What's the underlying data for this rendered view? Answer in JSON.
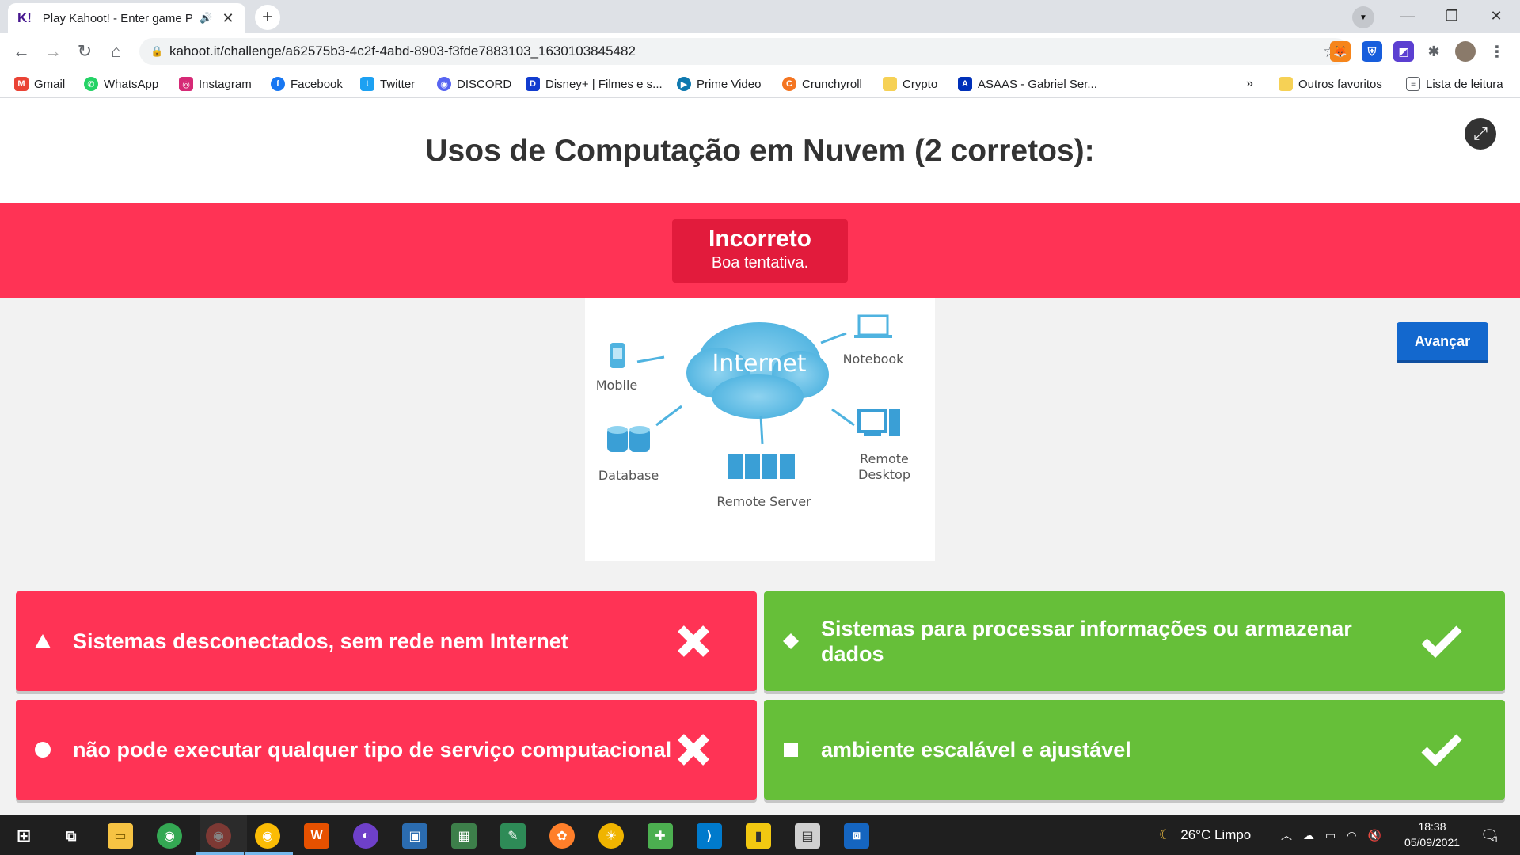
{
  "browser": {
    "tab": {
      "title": "Play Kahoot! - Enter game PIN",
      "favicon": "K!"
    },
    "url": "kahoot.it/challenge/a62575b3-4c2f-4abd-8903-f3fde7883103_1630103845482",
    "bookmarks": [
      {
        "label": "Gmail",
        "icon": "gmail-icon",
        "color": "#ea4335",
        "glyph": "M"
      },
      {
        "label": "WhatsApp",
        "icon": "whatsapp-icon",
        "color": "#25d366",
        "glyph": "✆"
      },
      {
        "label": "Instagram",
        "icon": "instagram-icon",
        "color": "#d62976",
        "glyph": "◎"
      },
      {
        "label": "Facebook",
        "icon": "facebook-icon",
        "color": "#1877f2",
        "glyph": "f"
      },
      {
        "label": "Twitter",
        "icon": "twitter-icon",
        "color": "#1da1f2",
        "glyph": "t"
      },
      {
        "label": "DISCORD",
        "icon": "discord-icon",
        "color": "#5865f2",
        "glyph": "◉"
      },
      {
        "label": "Disney+ | Filmes e s...",
        "icon": "disney-icon",
        "color": "#113ccf",
        "glyph": "D"
      },
      {
        "label": "Prime Video",
        "icon": "prime-video-icon",
        "color": "#0f79af",
        "glyph": "▶"
      },
      {
        "label": "Crunchyroll",
        "icon": "crunchyroll-icon",
        "color": "#f47521",
        "glyph": "C"
      },
      {
        "label": "Crypto",
        "icon": "folder-icon",
        "color": "#f6d155",
        "glyph": ""
      },
      {
        "label": "ASAAS - Gabriel Ser...",
        "icon": "asaas-icon",
        "color": "#0030b9",
        "glyph": "A"
      }
    ],
    "bookmarks_more": "»",
    "other_favorites": "Outros favoritos",
    "reading_list": "Lista de leitura"
  },
  "kahoot": {
    "question": "Usos de Computação em Nuvem (2 corretos):",
    "result": {
      "title": "Incorreto",
      "subtitle": "Boa tentativa."
    },
    "next_label": "Avançar",
    "diagram": {
      "center": "Internet",
      "labels": {
        "mobile": "Mobile",
        "notebook": "Notebook",
        "database": "Database",
        "server": "Remote Server",
        "desktop_line1": "Remote",
        "desktop_line2": "Desktop"
      }
    },
    "answers": [
      {
        "text": "Sistemas desconectados, sem rede nem Internet",
        "shape": "triangle",
        "correct": false
      },
      {
        "text": "Sistemas para processar informações ou armazenar dados",
        "shape": "diamond",
        "correct": true
      },
      {
        "text": "não pode executar qualquer tipo de serviço computacional",
        "shape": "circle",
        "correct": false
      },
      {
        "text": "ambiente escalável e ajustável",
        "shape": "square",
        "correct": true
      }
    ],
    "colors": {
      "wrong": "#ff3355",
      "right": "#66bf39",
      "result_bar": "#ff3355",
      "next": "#1368ce"
    }
  },
  "taskbar": {
    "weather": "26°C  Limpo",
    "time": "18:38",
    "date": "05/09/2021",
    "notifications": "1"
  }
}
